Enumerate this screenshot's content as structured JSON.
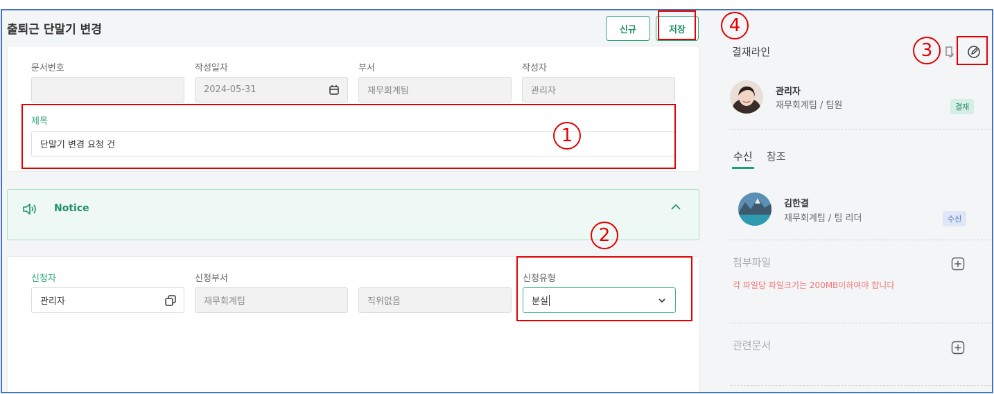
{
  "page": {
    "title": "출퇴근 단말기 변경",
    "new_button": "신규",
    "save_button": "저장"
  },
  "document": {
    "doc_no_label": "문서번호",
    "doc_no_value": "",
    "date_label": "작성일자",
    "date_value": "2024-05-31",
    "dept_label": "부서",
    "dept_value": "재무회계팀",
    "writer_label": "작성자",
    "writer_value": "관리자",
    "subject_label": "제목",
    "subject_value": "단말기 변경 요청 건"
  },
  "notice": {
    "title": "Notice"
  },
  "request": {
    "applicant_label": "신청자",
    "applicant_value": "관리자",
    "dept_label": "신청부서",
    "dept_value": "재무회계팀",
    "position_value": "직위없음",
    "type_label": "신청유형",
    "type_value": "분실"
  },
  "approval": {
    "title": "결재라인",
    "approver": {
      "name": "관리자",
      "dept": "재무회계팀 / 팀원",
      "badge": "결재"
    },
    "tabs": [
      "수신",
      "참조"
    ],
    "receiver": {
      "name": "김한결",
      "dept": "재무회계팀 / 팀 리더",
      "badge": "수신"
    }
  },
  "attachments": {
    "title": "첨부파일",
    "warning": "각 파일당 파일크기는 200MB이하여야 합니다"
  },
  "related": {
    "title": "관련문서"
  },
  "annotations": [
    "1",
    "2",
    "3",
    "4"
  ],
  "colors": {
    "accent": "#1f8f64",
    "annotation": "#e00000",
    "notice_bg": "#eef8f4",
    "approve_badge_bg": "#d5efe6",
    "receive_badge_bg": "#dfe6f7"
  }
}
